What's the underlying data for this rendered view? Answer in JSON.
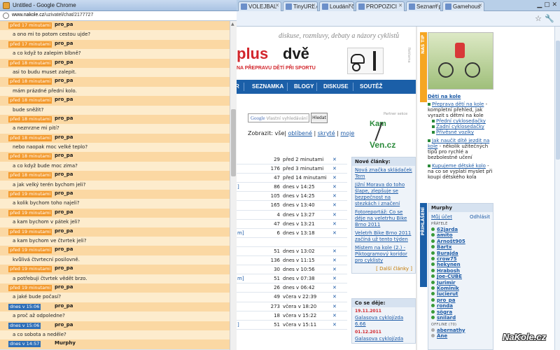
{
  "popup": {
    "title": "Untitled - Google Chrome",
    "url_domain": "www.nakole.cz",
    "url_path": "/uzivatel/chat/2177727",
    "messages": [
      {
        "time": "před 17 minutami",
        "author": "pro_pa",
        "text": "a ono mi to potom cestou ujde?",
        "recent": false
      },
      {
        "time": "před 17 minutami",
        "author": "pro_pa",
        "text": "a co když to zalepim blbně?",
        "recent": false
      },
      {
        "time": "před 18 minutami",
        "author": "pro_pa",
        "text": "asi to budu muset zalepit.",
        "recent": false
      },
      {
        "time": "před 18 minutami",
        "author": "pro_pa",
        "text": "mám prázdné přední kolo.",
        "recent": false
      },
      {
        "time": "před 18 minutami",
        "author": "pro_pa",
        "text": "bude sněžit?",
        "recent": false
      },
      {
        "time": "před 18 minutami",
        "author": "pro_pa",
        "text": "a neznrzne mi pití?",
        "recent": false
      },
      {
        "time": "před 18 minutami",
        "author": "pro_pa",
        "text": "nebo naopak moc velké teplo?",
        "recent": false
      },
      {
        "time": "před 18 minutami",
        "author": "pro_pa",
        "text": "a co když bude moc zima?",
        "recent": false
      },
      {
        "time": "před 18 minutami",
        "author": "pro_pa",
        "text": "a jak velký terén bychom jeli?",
        "recent": false
      },
      {
        "time": "před 19 minutami",
        "author": "pro_pa",
        "text": "a kolik bychom toho najeli?",
        "recent": false
      },
      {
        "time": "před 19 minutami",
        "author": "pro_pa",
        "text": "a kam bychom v pátek jeli?",
        "recent": false
      },
      {
        "time": "před 19 minutami",
        "author": "pro_pa",
        "text": "a kam bychom ve čtvrtek jeli?",
        "recent": false
      },
      {
        "time": "před 19 minutami",
        "author": "pro_pa",
        "text": "kvůlivá čtvrtecní posilovně.",
        "recent": false
      },
      {
        "time": "před 19 minutami",
        "author": "pro_pa",
        "text": "a potřebuji čtvrtek vědět brzo.",
        "recent": false
      },
      {
        "time": "před 19 minutami",
        "author": "pro_pa",
        "text": "a jaké bude počasí?",
        "recent": false
      },
      {
        "time": "dnes v 15:06",
        "author": "pro_pa",
        "text": "a proč až odpoledne?",
        "recent": true
      },
      {
        "time": "dnes v 15:06",
        "author": "pro_pa",
        "text": "a co sobota a neděle?",
        "recent": true
      },
      {
        "time": "dnes v 14:57",
        "author": "Murphy",
        "text": "",
        "recent": true
      }
    ]
  },
  "browser": {
    "tabs": [
      {
        "label": "VOLEJBAL"
      },
      {
        "label": "TinyURL.co"
      },
      {
        "label": "Loudání če"
      },
      {
        "label": "PROPOZICI"
      },
      {
        "label": "Seznam při"
      },
      {
        "label": "Gamehous"
      }
    ]
  },
  "site": {
    "slogan": "diskuse, rozmluvy, debaty a názory cyklistů",
    "logo_plus": "plus",
    "logo_dve": "dvě",
    "logo_sub": "NA PŘEPRAVU DĚTÍ PŘI SPORTU",
    "reklama": "Reklama",
    "nav": [
      "R",
      "SEZNAMKA",
      "BLOGY",
      "DISKUSE",
      "SOUTĚŽ"
    ],
    "google_label": "Google",
    "google_placeholder": "Vlastní vyhledávání",
    "search_button": "Hledat",
    "zobrazit_label": "Zobrazit:",
    "zobrazit_all": "vše",
    "zobrazit_links": [
      "oblíbené",
      "skryté",
      "moje"
    ],
    "partner_label": "Partner sekce",
    "kamven_1": "Kam",
    "kamven_2": "Ven.cz",
    "rows": [
      {
        "bracket": "",
        "num": "29",
        "time": "před 2 minutami"
      },
      {
        "bracket": "",
        "num": "176",
        "time": "před 3 minutami"
      },
      {
        "bracket": "",
        "num": "47",
        "time": "před 14 minutami"
      },
      {
        "bracket": "]",
        "num": "86",
        "time": "dnes v 14:25"
      },
      {
        "bracket": "",
        "num": "105",
        "time": "dnes v 14:25"
      },
      {
        "bracket": "",
        "num": "165",
        "time": "dnes v 13:40"
      },
      {
        "bracket": "",
        "num": "4",
        "time": "dnes v 13:27"
      },
      {
        "bracket": "",
        "num": "47",
        "time": "dnes v 13:21"
      },
      {
        "bracket": "m]",
        "num": "6",
        "time": "dnes v 13:18"
      },
      {
        "bracket": "",
        "num": "",
        "time": ""
      },
      {
        "bracket": "",
        "num": "51",
        "time": "dnes v 13:02"
      },
      {
        "bracket": "",
        "num": "136",
        "time": "dnes v 11:15"
      },
      {
        "bracket": "",
        "num": "30",
        "time": "dnes v 10:56"
      },
      {
        "bracket": "m]",
        "num": "51",
        "time": "dnes v 07:38"
      },
      {
        "bracket": "",
        "num": "26",
        "time": "dnes v 06:42"
      },
      {
        "bracket": "",
        "num": "49",
        "time": "včera v 22:39"
      },
      {
        "bracket": "",
        "num": "273",
        "time": "včera v 18:20"
      },
      {
        "bracket": "",
        "num": "18",
        "time": "včera v 15:22"
      },
      {
        "bracket": "]",
        "num": "51",
        "time": "včera v 15:11"
      }
    ],
    "new_articles": {
      "header": "Nové články:",
      "items": [
        "Nová značka skládaček Tern",
        "Jižní Morava do toho šlape, zlepšuje se bezpečnost na stezkách i značení",
        "Fotoreportáž: Co se děje na veletrhu Bike Brno 2011",
        "Veletrh Bike Brno 2011 začíná už tento týden",
        "Místem na kole (2.) - Piktogramový koridor pro cyklisty"
      ],
      "more": "[ Další články ]"
    },
    "events": {
      "header": "Co se děje:",
      "items": [
        {
          "date": "19.11.2011",
          "title": "Galasova cyklojízda 6.66"
        },
        {
          "date": "01.12.2011",
          "title": "Galasova cyklojízda"
        }
      ]
    },
    "tip_label": "NÁŠ TIP",
    "tip": {
      "heading": "Děti na kole",
      "items": [
        {
          "title": "Přeprava dětí na kole",
          "text": " - kompletní přehled, jak vyrazit s dětmi na kole",
          "subs": [
            "Přední cyklosedačky",
            "Zadní cyklosedačky",
            "Přívěsné vozíky"
          ]
        },
        {
          "title": "Jak naučit dítě jezdit na kole",
          "text": " - několik užitečných tipů pro rychlé a bezbolestné učení",
          "subs": []
        },
        {
          "title": "Kupujeme dětské kolo",
          "text": " - na co se vyplatí myslet při koupi dětského kola",
          "subs": []
        }
      ]
    },
    "login_label": "PŘIHLÁŠENÍ",
    "login": {
      "user": "Murphy",
      "my_account": "Můj účet",
      "logout": "Odhlásit",
      "friends_label": "PŘÁTELÉ",
      "friends": [
        "62jarda",
        "amito",
        "Arnošt905",
        "Bartx",
        "Burajda",
        "crow75",
        "hekynen",
        "Hrabosh",
        "Joe-CUBE",
        "Jurimir",
        "Kominík",
        "lucierut",
        "pro_pa",
        "ronda",
        "sögra",
        "snilard"
      ],
      "offline_label": "OFFLINE (70)",
      "offline": [
        "abernathy",
        "Ane"
      ]
    },
    "watermark": "NaKole.cz"
  }
}
